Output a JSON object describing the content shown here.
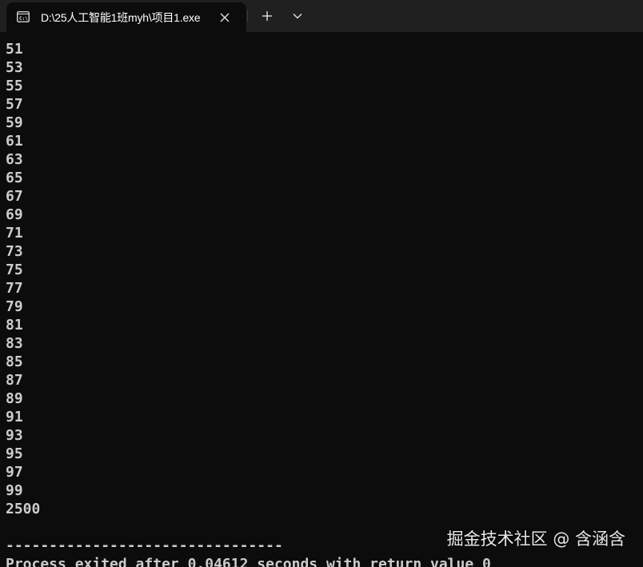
{
  "tab": {
    "title": "D:\\25人工智能1班myh\\项目1.exe",
    "icon": "terminal-icon"
  },
  "controls": {
    "close_glyph": "✕",
    "new_tab_glyph": "+",
    "dropdown_glyph": "⌄"
  },
  "console": {
    "lines": [
      "51",
      "53",
      "55",
      "57",
      "59",
      "61",
      "63",
      "65",
      "67",
      "69",
      "71",
      "73",
      "75",
      "77",
      "79",
      "81",
      "83",
      "85",
      "87",
      "89",
      "91",
      "93",
      "95",
      "97",
      "99",
      "2500",
      "",
      "--------------------------------",
      "Process exited after 0.04612 seconds with return value 0"
    ]
  },
  "watermark": {
    "text": "掘金技术社区 @ 含涵含"
  },
  "colors": {
    "background": "#0c0c0c",
    "tabbar": "#202020",
    "text": "#cccccc"
  }
}
